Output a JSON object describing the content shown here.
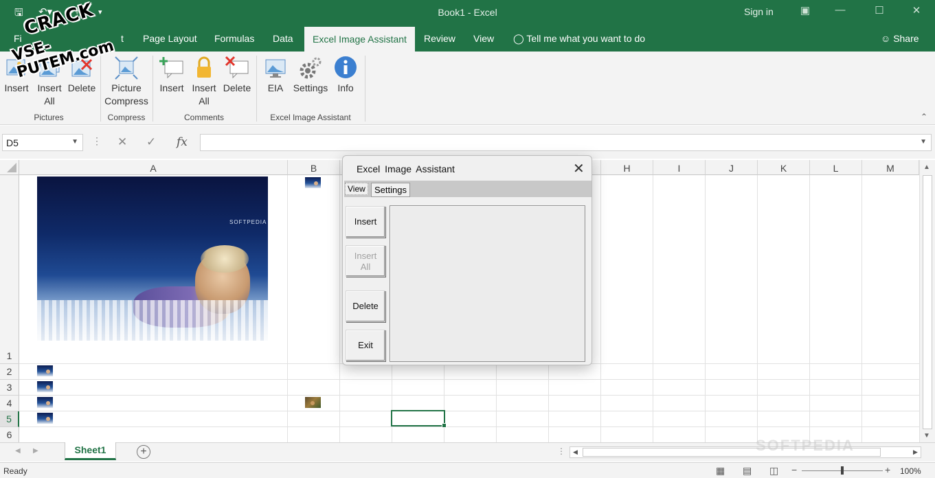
{
  "window": {
    "title": "Book1  -  Excel",
    "sign_in": "Sign in"
  },
  "ribbon_tabs": {
    "file": "Fi",
    "hidden_tab_tail": "t",
    "page_layout": "Page Layout",
    "formulas": "Formulas",
    "data": "Data",
    "excel_image_assistant": "Excel Image Assistant",
    "review": "Review",
    "view": "View",
    "tell_me": "Tell me what you want to do",
    "share": "Share"
  },
  "ribbon": {
    "pictures": {
      "insert": "Insert",
      "insert_all": "Insert All",
      "delete": "Delete",
      "label": "Pictures"
    },
    "compress": {
      "picture_compress": "Picture Compress",
      "label": "Compress"
    },
    "comments": {
      "insert": "Insert",
      "insert_all": "Insert All",
      "delete": "Delete",
      "label": "Comments"
    },
    "eia": {
      "eia": "EIA",
      "settings": "Settings",
      "info": "Info",
      "label": "Excel Image Assistant"
    }
  },
  "formula_bar": {
    "name_box": "D5",
    "formula": ""
  },
  "grid": {
    "columns": [
      "A",
      "B",
      "",
      "",
      "",
      "",
      "",
      "H",
      "I",
      "J",
      "K",
      "L",
      "M"
    ],
    "rows": [
      "1",
      "2",
      "3",
      "4",
      "5",
      "6"
    ],
    "selected_cell": "D5",
    "image_brand": "SOFTPEDIA"
  },
  "dialog": {
    "title": "Excel  Image  Assistant",
    "tabs": {
      "view": "View",
      "settings": "Settings"
    },
    "buttons": {
      "insert": "Insert",
      "insert_all_1": "Insert",
      "insert_all_2": "All",
      "delete": "Delete",
      "exit": "Exit"
    }
  },
  "sheets": {
    "active": "Sheet1"
  },
  "status": {
    "ready": "Ready",
    "zoom": "100%"
  },
  "watermarks": {
    "crack_line1": "CRACK",
    "crack_line2": "VSE-PUTEM.com",
    "softpedia": "SOFTPEDIA"
  },
  "colors": {
    "excel_green": "#217346",
    "ribbon_bg": "#f3f3f3",
    "dialog_bg": "#f0f0f0"
  }
}
